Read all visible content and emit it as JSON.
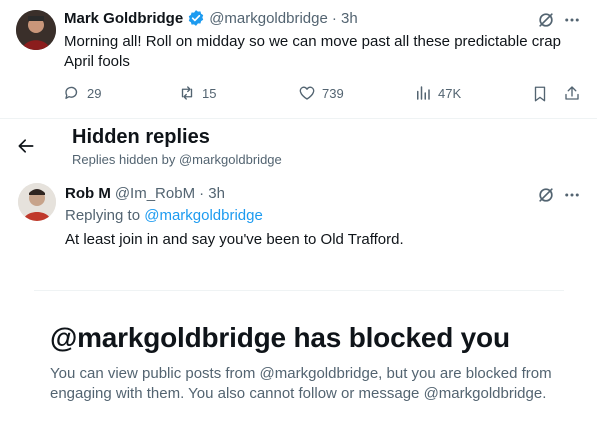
{
  "main_post": {
    "name": "Mark Goldbridge",
    "handle": "@markgoldbridge",
    "time": "· 3h",
    "text_line1": "Morning all! Roll on midday so we can move past all these predictable crap",
    "text_line2": "April fools",
    "stats": {
      "replies": "29",
      "reposts": "15",
      "likes": "739",
      "views": "47K"
    }
  },
  "hidden_replies": {
    "title": "Hidden replies",
    "subtitle": "Replies hidden by @markgoldbridge"
  },
  "reply": {
    "name": "Rob M",
    "handle": "@Im_RobM",
    "time": "· 3h",
    "replying_prefix": "Replying to",
    "replying_to": "@markgoldbridge",
    "text": "At least join in and say you've been to Old Trafford."
  },
  "blocked": {
    "title": "@markgoldbridge has blocked you",
    "line1": "You can view public posts from @markgoldbridge, but you are blocked from",
    "line2": "engaging with them. You also cannot follow or message @markgoldbridge."
  },
  "colors": {
    "accent": "#1d9bf0",
    "muted": "#536471",
    "text": "#0f1419"
  }
}
